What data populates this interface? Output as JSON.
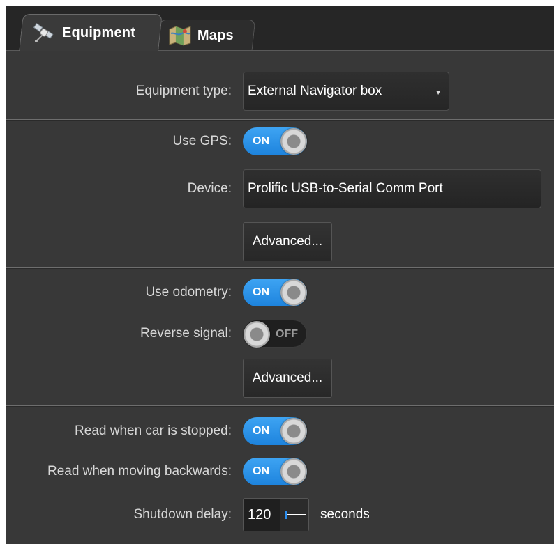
{
  "tabs": [
    {
      "label": "Equipment",
      "icon": "satellite-icon",
      "active": true
    },
    {
      "label": "Maps",
      "icon": "map-icon",
      "active": false
    }
  ],
  "equipment_type": {
    "label": "Equipment type:",
    "value": "External Navigator box"
  },
  "gps": {
    "use_label": "Use GPS:",
    "use_state": "ON",
    "device_label": "Device:",
    "device_value": "Prolific USB-to-Serial Comm Port",
    "advanced_label": "Advanced..."
  },
  "odometry": {
    "use_label": "Use odometry:",
    "use_state": "ON",
    "reverse_label": "Reverse signal:",
    "reverse_state": "OFF",
    "advanced_label": "Advanced..."
  },
  "reading": {
    "stopped_label": "Read when car is stopped:",
    "stopped_state": "ON",
    "backwards_label": "Read when moving backwards:",
    "backwards_state": "ON",
    "shutdown_label": "Shutdown delay:",
    "shutdown_value": "120",
    "shutdown_unit": "seconds"
  },
  "colors": {
    "toggle_on": "#2a8df0",
    "panel_bg": "#383838"
  }
}
